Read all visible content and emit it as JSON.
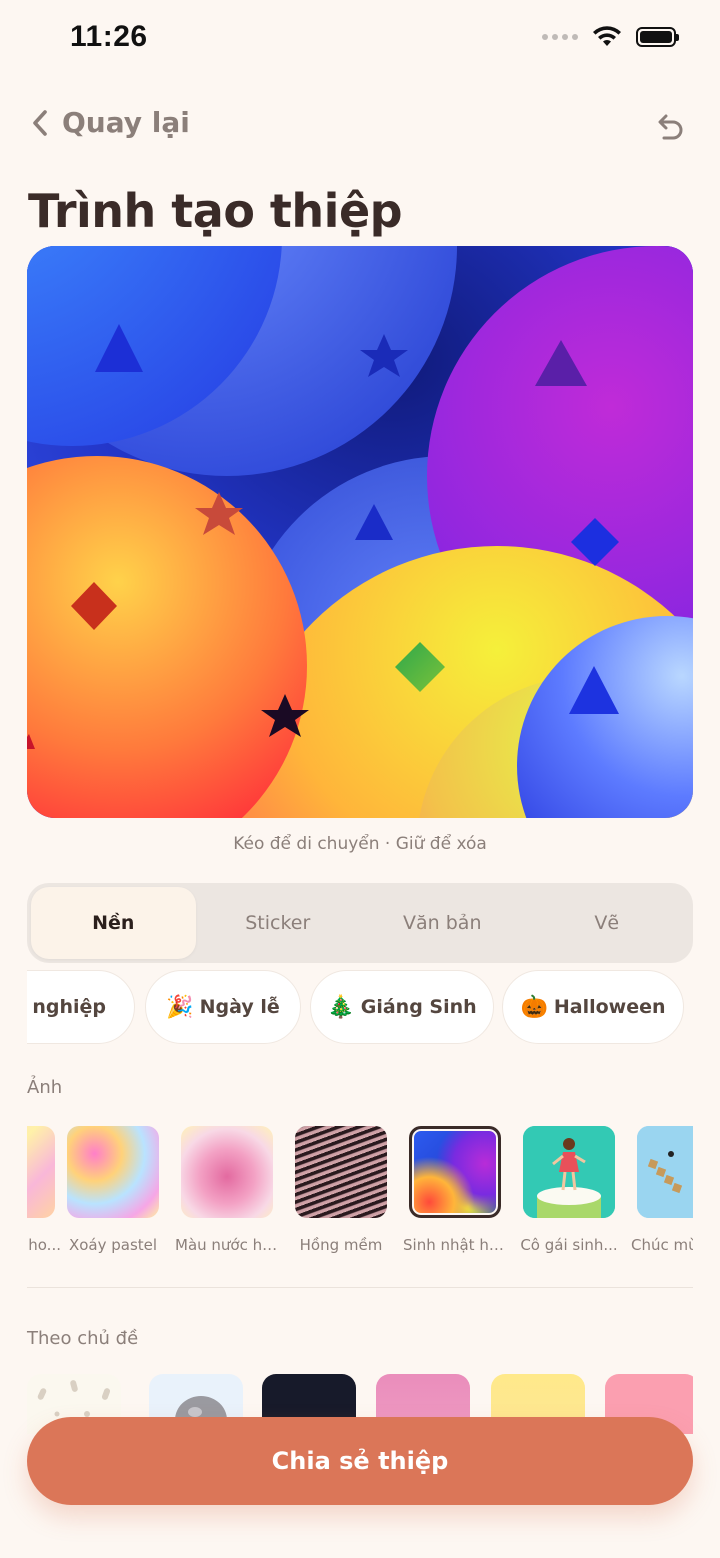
{
  "status_bar": {
    "time": "11:26"
  },
  "header": {
    "back_label": "Quay lại",
    "back_icon": "chevron-left-icon",
    "undo_icon": "undo-icon"
  },
  "page": {
    "title": "Trình tạo thiệp",
    "canvas_hint": "Kéo để di chuyển · Giữ để xóa"
  },
  "tabs": [
    {
      "label": "Nền",
      "active": true
    },
    {
      "label": "Sticker",
      "active": false
    },
    {
      "label": "Văn bản",
      "active": false
    },
    {
      "label": "Vẽ",
      "active": false
    }
  ],
  "category_chips": [
    {
      "emoji": "",
      "label": "ốt nghiệp"
    },
    {
      "emoji": "🎉",
      "label": "Ngày lễ"
    },
    {
      "emoji": "🎄",
      "label": "Giáng Sinh"
    },
    {
      "emoji": "🎃",
      "label": "Halloween"
    }
  ],
  "photos_section": {
    "label": "Ảnh",
    "items": [
      {
        "label": "ho..."
      },
      {
        "label": "Xoáy pastel"
      },
      {
        "label": "Màu nước hồng"
      },
      {
        "label": "Hồng mềm"
      },
      {
        "label": "Sinh nhật hoạt...",
        "selected": true
      },
      {
        "label": "Cô gái sinh..."
      },
      {
        "label": "Chúc mừ"
      }
    ]
  },
  "themes_section": {
    "label": "Theo chủ đề"
  },
  "share_button": {
    "label": "Chia sẻ thiệp"
  },
  "colors": {
    "accent": "#db7658",
    "background": "#fdf7f2",
    "title": "#3a2b28",
    "muted": "#8b7f7a"
  }
}
